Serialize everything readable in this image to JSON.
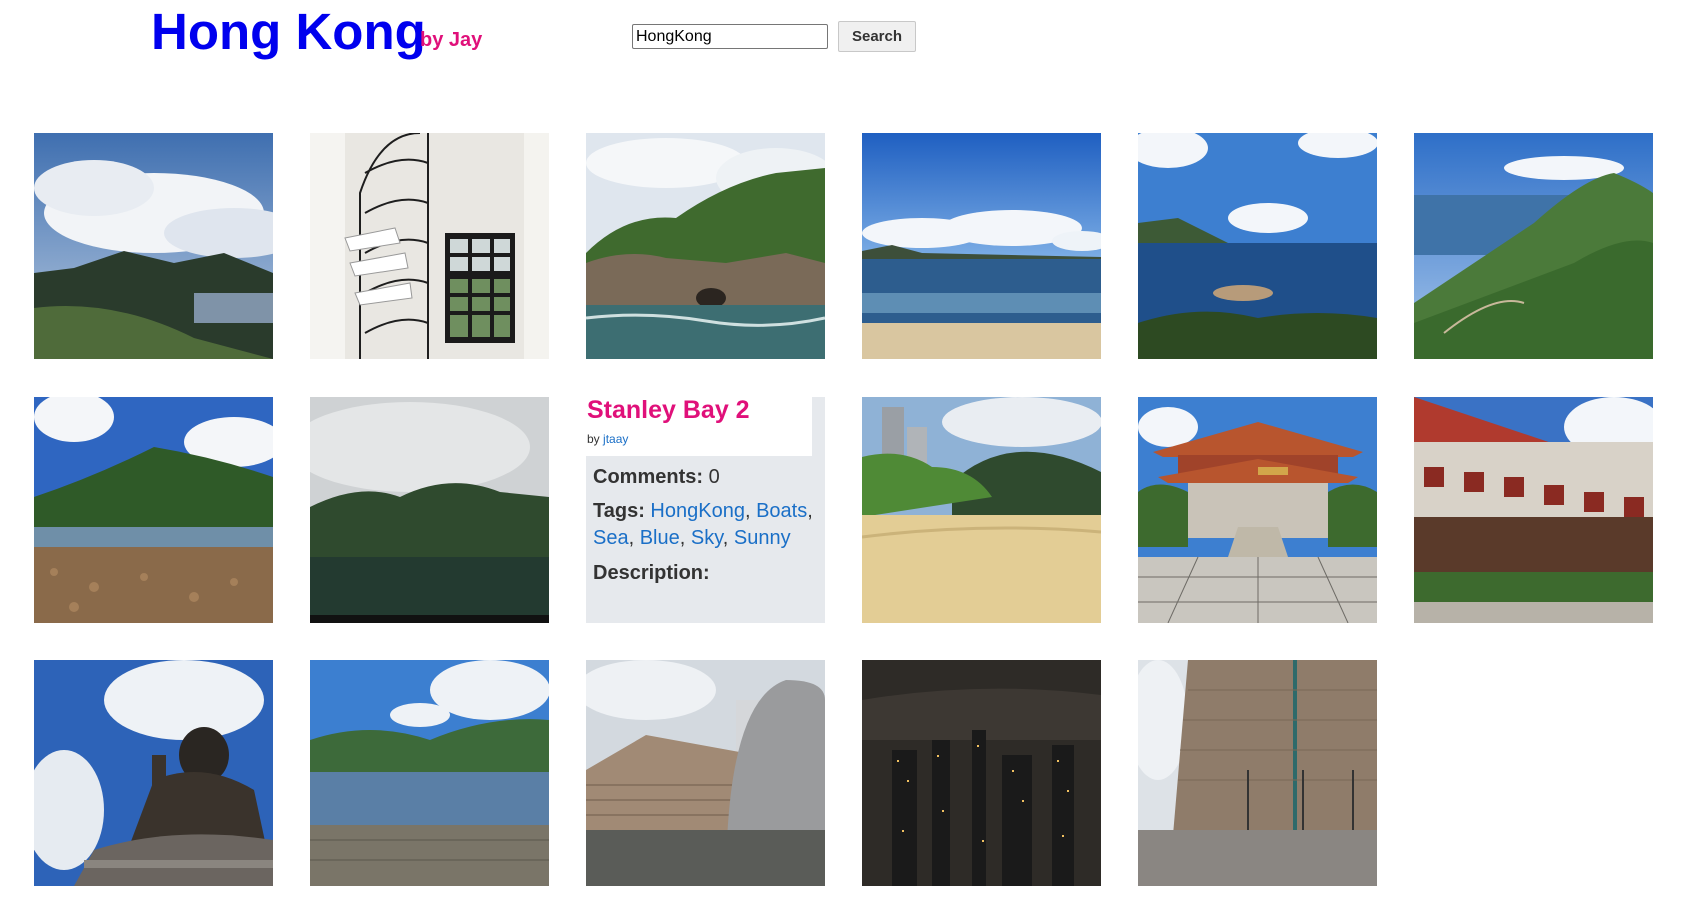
{
  "header": {
    "title": "Hong Kong",
    "byline": "by Jay",
    "search_value": "HongKong",
    "search_button": "Search"
  },
  "colors": {
    "title": "#0000ee",
    "accent": "#e0107a",
    "link": "#1a6fc7"
  },
  "photos": [
    {
      "scene": "mountain-valley-clouds"
    },
    {
      "scene": "spiral-staircase-window"
    },
    {
      "scene": "rocky-island-sea"
    },
    {
      "scene": "beach-blue-sky"
    },
    {
      "scene": "bay-island-view"
    },
    {
      "scene": "green-hillside-coast"
    },
    {
      "scene": "pebble-shore-mountain"
    },
    {
      "scene": "reservoir-cloudy-hills"
    },
    {
      "scene": "stanley-bay-2-info-card"
    },
    {
      "scene": "sandy-beach-trees"
    },
    {
      "scene": "temple-courtyard"
    },
    {
      "scene": "temple-building-facade"
    },
    {
      "scene": "big-buddha-statue"
    },
    {
      "scene": "reservoir-wall-hills"
    },
    {
      "scene": "dome-building"
    },
    {
      "scene": "city-night-skyline"
    },
    {
      "scene": "tall-tower-plaza"
    }
  ],
  "info_card": {
    "title": "Stanley Bay 2",
    "by_prefix": "by",
    "author": "jtaay",
    "comments_label": "Comments:",
    "comments_count": "0",
    "tags_label": "Tags:",
    "tags": [
      "HongKong",
      "Boats",
      "Sea",
      "Blue",
      "Sky",
      "Sunny"
    ],
    "description_label": "Description:"
  }
}
